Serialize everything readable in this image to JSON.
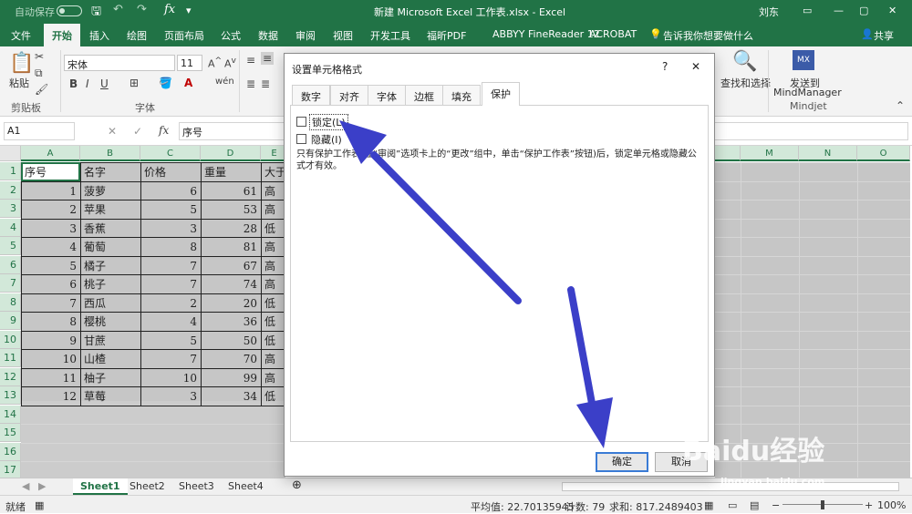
{
  "titlebar": {
    "autosave": "自动保存",
    "toggle_state": "关",
    "title": "新建 Microsoft Excel 工作表.xlsx  -  Excel",
    "user": "刘东",
    "minimize": "—",
    "restore": "▢",
    "close": "✕"
  },
  "tabs": [
    "文件",
    "开始",
    "插入",
    "绘图",
    "页面布局",
    "公式",
    "数据",
    "审阅",
    "视图",
    "开发工具",
    "福昕PDF",
    "ABBYY FineReader 12",
    "ACROBAT",
    "告诉我你想要做什么"
  ],
  "share": "共享",
  "ribbon": {
    "paste": "粘贴",
    "clipboard_group": "剪贴板",
    "font_name": "宋体",
    "font_size": "11",
    "font_group": "字体",
    "bold": "B",
    "italic": "I",
    "underline": "U",
    "find_select": "查找和选择",
    "send_mindmanager": "发送到",
    "send_mindmanager2": "MindManager",
    "mindjet_group": "Mindjet"
  },
  "formula_bar": {
    "name_box": "A1",
    "cancel": "✕",
    "enter": "✓",
    "fx": "fx",
    "value": "序号"
  },
  "columns": [
    "A",
    "B",
    "C",
    "D",
    "E",
    "M",
    "N",
    "O"
  ],
  "rows": [
    "1",
    "2",
    "3",
    "4",
    "5",
    "6",
    "7",
    "8",
    "9",
    "10",
    "11",
    "12",
    "13",
    "14",
    "15",
    "16",
    "17"
  ],
  "table": {
    "headers": [
      "序号",
      "名字",
      "价格",
      "重量",
      "大于"
    ],
    "rows": [
      [
        "1",
        "菠萝",
        "6",
        "61",
        "高"
      ],
      [
        "2",
        "苹果",
        "5",
        "53",
        "高"
      ],
      [
        "3",
        "香蕉",
        "3",
        "28",
        "低"
      ],
      [
        "4",
        "葡萄",
        "8",
        "81",
        "高"
      ],
      [
        "5",
        "橘子",
        "7",
        "67",
        "高"
      ],
      [
        "6",
        "桃子",
        "7",
        "74",
        "高"
      ],
      [
        "7",
        "西瓜",
        "2",
        "20",
        "低"
      ],
      [
        "8",
        "樱桃",
        "4",
        "36",
        "低"
      ],
      [
        "9",
        "甘蔗",
        "5",
        "50",
        "低"
      ],
      [
        "10",
        "山楂",
        "7",
        "70",
        "高"
      ],
      [
        "11",
        "柚子",
        "10",
        "99",
        "高"
      ],
      [
        "12",
        "草莓",
        "3",
        "34",
        "低"
      ]
    ]
  },
  "sheets": [
    "Sheet1",
    "Sheet2",
    "Sheet3",
    "Sheet4"
  ],
  "status": {
    "ready": "就绪",
    "average": "平均值: 22.70135945",
    "count": "计数: 79",
    "sum": "求和: 817.2489403",
    "zoom": "100%"
  },
  "dialog": {
    "title": "设置单元格格式",
    "help": "?",
    "close": "✕",
    "tabs": [
      "数字",
      "对齐",
      "字体",
      "边框",
      "填充",
      "保护"
    ],
    "active_tab": "保护",
    "lock_label": "锁定(L)",
    "lock_checked": false,
    "hide_label": "隐藏(I)",
    "hide_checked": false,
    "description": "只有保护工作表(在“审阅”选项卡上的“更改”组中，单击“保护工作表”按钮)后，锁定单元格或隐藏公式才有效。",
    "ok": "确定",
    "cancel": "取消"
  },
  "watermark": {
    "brand": "Baidu经验",
    "url": "jingyan.baidu.com"
  },
  "colors": {
    "excel_green": "#217346",
    "arrow": "#3b3fc8",
    "selection_shade": "#c6c6c6"
  }
}
